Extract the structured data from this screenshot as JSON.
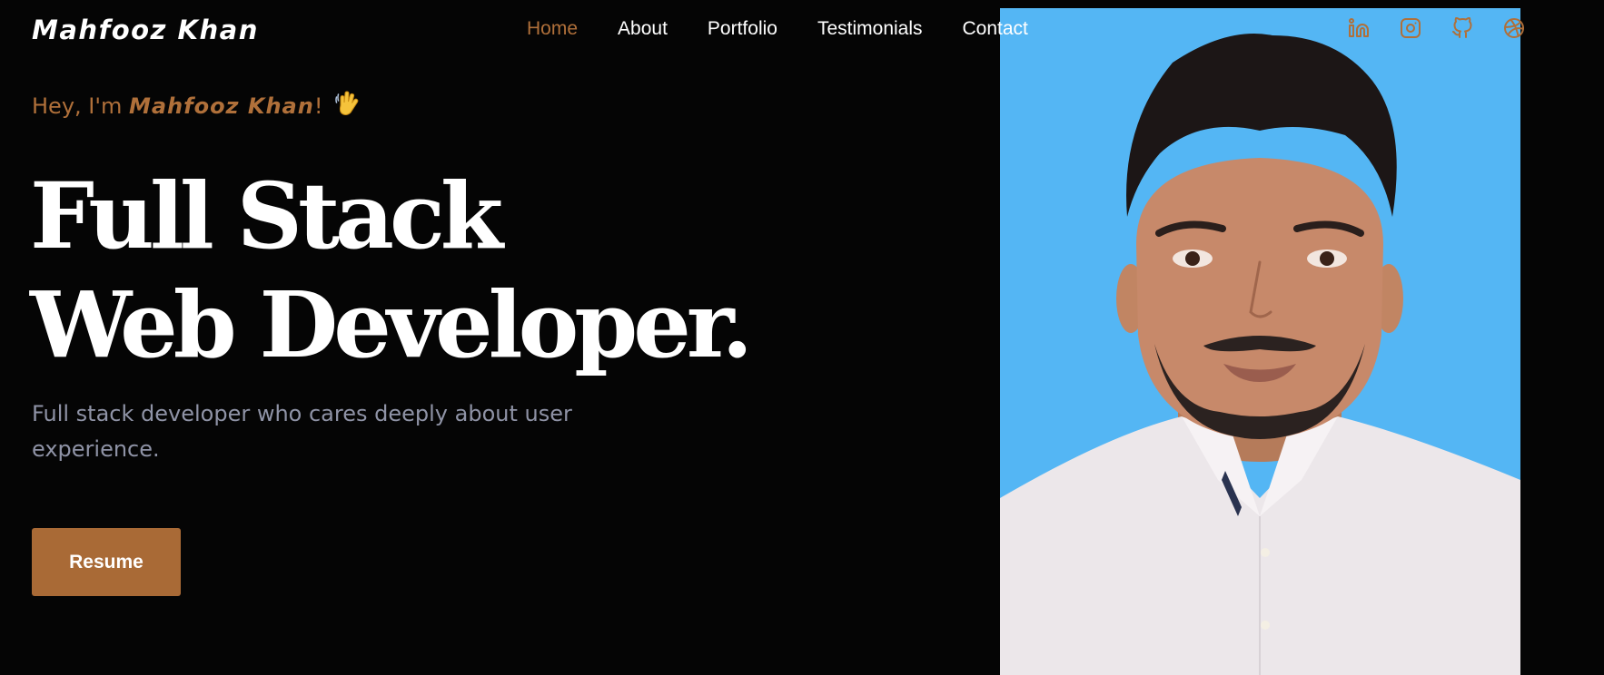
{
  "brand": {
    "name": "Mahfooz Khan"
  },
  "nav": {
    "items": [
      {
        "label": "Home",
        "active": true
      },
      {
        "label": "About"
      },
      {
        "label": "Portfolio"
      },
      {
        "label": "Testimonials"
      },
      {
        "label": "Contact"
      }
    ]
  },
  "socials": {
    "icons": [
      "linkedin-icon",
      "instagram-icon",
      "github-icon",
      "dribbble-icon"
    ]
  },
  "hero": {
    "greeting_prefix": "Hey, I'm ",
    "greeting_name": "Mahfooz Khan",
    "greeting_suffix": "!",
    "wave_emoji": "👋",
    "headline_line1": "Full Stack",
    "headline_line2": "Web Developer.",
    "subtext": "Full stack developer who cares deeply about user experience.",
    "resume_label": "Resume"
  },
  "profile_photo": {
    "subject": "portrait of a man in a white floral shirt on a blue background"
  },
  "colors": {
    "background": "#050505",
    "accent": "#b0703a",
    "button": "#a96a36",
    "subtext": "#8f93a6",
    "photo_background": "#54b6f4"
  }
}
